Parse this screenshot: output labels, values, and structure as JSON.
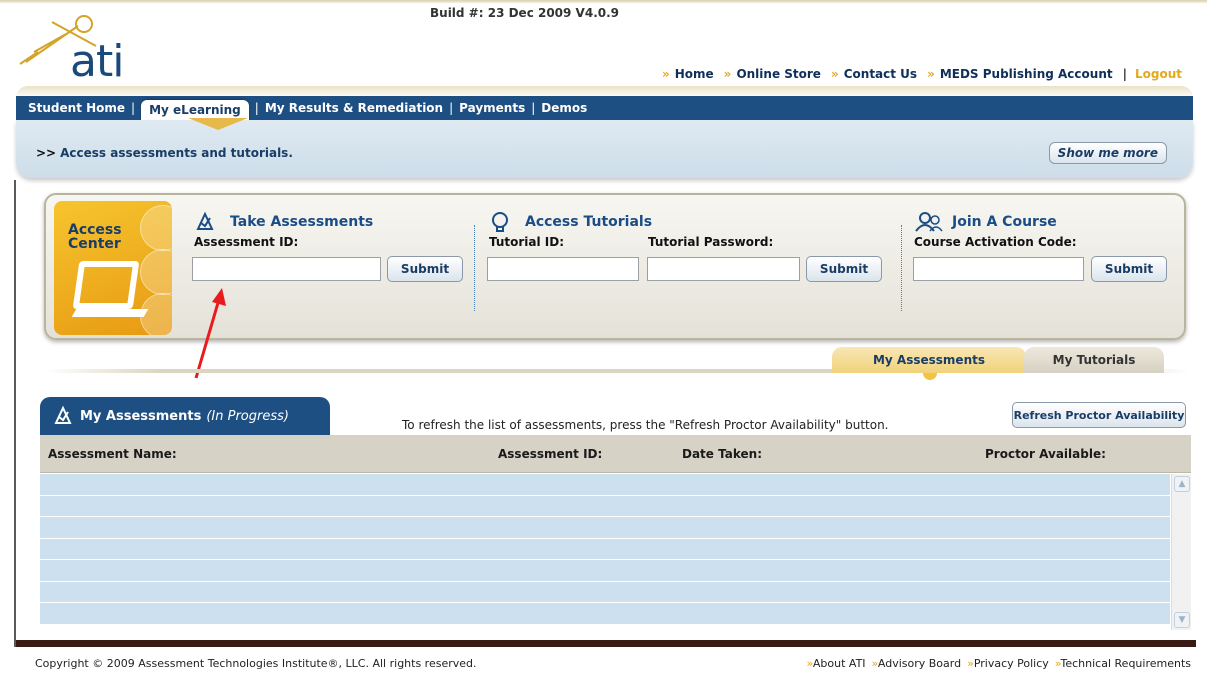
{
  "header": {
    "build": "Build #: 23 Dec 2009 V4.0.9",
    "logo_text": "ati",
    "nav": [
      {
        "label": "Home"
      },
      {
        "label": "Online Store"
      },
      {
        "label": "Contact Us"
      },
      {
        "label": "MEDS Publishing Account"
      }
    ],
    "separator": "|",
    "logout": "Logout"
  },
  "tabs": [
    {
      "label": "Student Home",
      "active": false
    },
    {
      "label": "My eLearning",
      "active": true
    },
    {
      "label": "My Results & Remediation",
      "active": false
    },
    {
      "label": "Payments",
      "active": false
    },
    {
      "label": "Demos",
      "active": false
    }
  ],
  "tab_separator": "|",
  "infobar": {
    "arrows": ">>",
    "message": "Access assessments and tutorials.",
    "show_more": "Show me more"
  },
  "access_center": {
    "badge_line1": "Access",
    "badge_line2": "Center",
    "take_assessments": {
      "title": "Take Assessments",
      "field_label": "Assessment ID:",
      "value": "",
      "submit": "Submit"
    },
    "access_tutorials": {
      "title": "Access Tutorials",
      "id_label": "Tutorial ID:",
      "password_label": "Tutorial Password:",
      "id_value": "",
      "password_value": "",
      "submit": "Submit"
    },
    "join_course": {
      "title": "Join A Course",
      "field_label": "Course Activation Code:",
      "value": "",
      "submit": "Submit"
    }
  },
  "subtabs": {
    "active": "My Assessments",
    "inactive": "My Tutorials"
  },
  "assessments_panel": {
    "title": "My Assessments",
    "subtitle": "(In Progress)",
    "refresh_message": "To refresh the list of assessments, press the \"Refresh Proctor Availability\" button.",
    "refresh_button": "Refresh Proctor Availability",
    "columns": [
      "Assessment Name:",
      "Assessment ID:",
      "Date Taken:",
      "Proctor Available:"
    ],
    "rows": []
  },
  "footer": {
    "copyright": "Copyright © 2009 Assessment Technologies Institute®, LLC. All rights reserved.",
    "links": [
      "About ATI",
      "Advisory Board",
      "Privacy Policy",
      "Technical Requirements"
    ]
  },
  "colors": {
    "brand_blue": "#1e4f83",
    "accent_gold": "#e4a81b",
    "row_blue": "#cde0ef"
  }
}
